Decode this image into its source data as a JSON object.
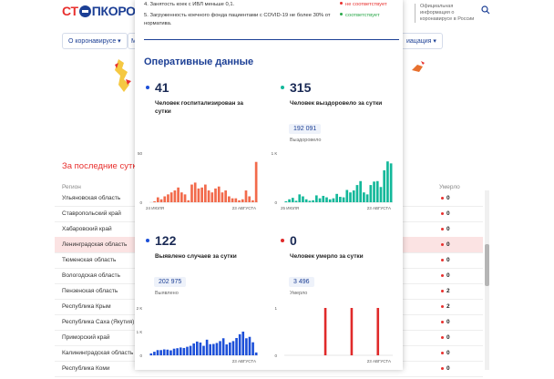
{
  "header": {
    "logo_part1": "СТ",
    "logo_part2": "ПКОРОНАВ",
    "official_info": "Официальная информация о коронавирусе в России"
  },
  "nav": {
    "about": "О коронавирусе ▾",
    "m_fragment": "М",
    "info_fragment": "иацация ▾"
  },
  "background": {
    "last_days": "За последние сутк",
    "col_region": "Регион",
    "col_died": "Умерло",
    "rows": [
      {
        "name": "Ульяновская область",
        "val": "0"
      },
      {
        "name": "Ставропольский край",
        "val": "0"
      },
      {
        "name": "Хабаровский край",
        "val": "0"
      },
      {
        "name": "Ленинградская область",
        "val": "0"
      },
      {
        "name": "Тюменская область",
        "val": "0"
      },
      {
        "name": "Вологодская область",
        "val": "0"
      },
      {
        "name": "Пензенская область",
        "val": "2"
      },
      {
        "name": "Республика Крым",
        "val": "2"
      },
      {
        "name": "Республика Саха (Якутия)",
        "val": "0"
      },
      {
        "name": "Приморский край",
        "val": "0"
      },
      {
        "name": "Калининградская область",
        "val": "0"
      },
      {
        "name": "Республика Коми",
        "val": "0"
      }
    ]
  },
  "modal": {
    "criteria": [
      {
        "text": "4. Занятость коек с ИВЛ меньше 0,1.",
        "status": "не соответствует",
        "color": "#e8302e"
      },
      {
        "text": "5. Загруженность коечного фонда пациентами с COVID-19 не более 30% от",
        "status": "соответствует",
        "color": "#2aa84a"
      },
      {
        "text": "норматива.",
        "status": "",
        "color": ""
      }
    ],
    "title": "Оперативные данные",
    "stats": [
      {
        "number": "41",
        "label": "Человек госпитализирован за сутки",
        "color": "#1c4fd8",
        "badge": "",
        "sub": ""
      },
      {
        "number": "315",
        "label": "Человек выздоровело за сутки",
        "color": "#13b89a",
        "badge": "192 091",
        "sub": "Выздоровело"
      },
      {
        "number": "122",
        "label": "Выявлено случаев за сутки",
        "color": "#1c4fd8",
        "badge": "202 975",
        "sub": "Выявлено"
      },
      {
        "number": "0",
        "label": "Человек умерло за сутки",
        "color": "#e02a2a",
        "badge": "3 496",
        "sub": "Умерло"
      }
    ]
  },
  "chart_data": [
    {
      "type": "bar",
      "color": "#f26a4b",
      "ylim": [
        0,
        50
      ],
      "yticks": [
        "50",
        "0"
      ],
      "x_start_label": "24 ИЮЛЯ",
      "x_end_label": "23 АВГУСТА",
      "values": [
        0,
        1,
        5,
        3,
        6,
        8,
        10,
        12,
        15,
        10,
        8,
        2,
        18,
        20,
        14,
        15,
        18,
        12,
        10,
        14,
        16,
        10,
        12,
        6,
        4,
        4,
        2,
        3,
        12,
        6,
        2,
        41
      ]
    },
    {
      "type": "bar",
      "color": "#13b89a",
      "ylim": [
        0,
        1000
      ],
      "yticks": [
        "1 К",
        "0"
      ],
      "x_start_label": "25 ИЮЛЯ",
      "x_end_label": "23 АВГУСТА",
      "values": [
        20,
        60,
        90,
        30,
        160,
        120,
        60,
        30,
        40,
        140,
        80,
        130,
        100,
        60,
        80,
        170,
        110,
        100,
        250,
        200,
        240,
        350,
        430,
        200,
        160,
        350,
        420,
        430,
        310,
        650,
        830,
        790
      ]
    },
    {
      "type": "bar",
      "color": "#1c4fd8",
      "ylim": [
        0,
        2000
      ],
      "yticks": [
        "2 К",
        "1 К",
        "0"
      ],
      "x_start_label": "",
      "x_end_label": "23 АВГУСТА",
      "values": [
        80,
        150,
        220,
        220,
        250,
        240,
        210,
        280,
        300,
        330,
        310,
        360,
        400,
        500,
        580,
        540,
        400,
        660,
        470,
        480,
        520,
        600,
        720,
        460,
        540,
        600,
        730,
        890,
        1000,
        720,
        780,
        550,
        120
      ]
    },
    {
      "type": "bar",
      "color": "#e02a2a",
      "ylim": [
        0,
        1
      ],
      "yticks": [
        "1",
        "0"
      ],
      "x_start_label": "",
      "x_end_label": "23 АВГУСТА",
      "values": [
        0,
        0,
        0,
        0,
        0,
        0,
        0,
        0,
        0,
        0,
        0,
        0,
        1,
        0,
        0,
        0,
        0,
        0,
        0,
        0,
        1,
        0,
        0,
        0,
        0,
        0,
        0,
        0,
        1,
        0,
        0,
        0,
        0
      ]
    }
  ]
}
